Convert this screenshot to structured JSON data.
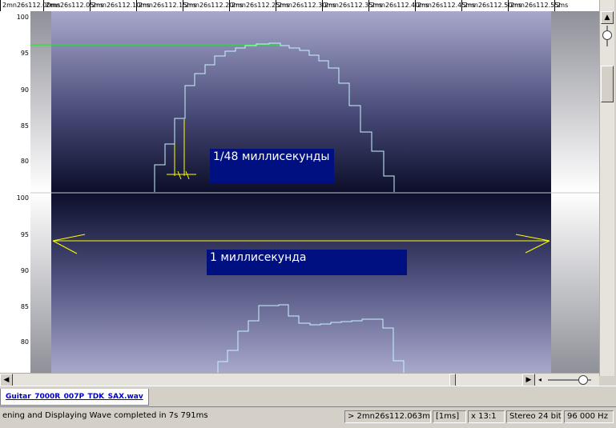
{
  "ruler": {
    "ticks": [
      "2mn26s112.00ms",
      "2mn26s112.05ms",
      "2mn26s112.10ms",
      "2mn26s112.15ms",
      "2mn26s112.20ms",
      "2mn26s112.25ms",
      "2mn26s112.30ms",
      "2mn26s112.35ms",
      "2mn26s112.40ms",
      "2mn26s112.45ms",
      "2mn26s112.50ms",
      "2mn26s112.55ms",
      "2"
    ]
  },
  "axis": {
    "top_labels": [
      "100",
      "95",
      "90",
      "85",
      "80"
    ],
    "bottom_labels": [
      "100",
      "95",
      "90",
      "85",
      "80"
    ]
  },
  "annotations": {
    "sample_label": "1/48 миллисекунды",
    "ms_label": "1 миллисекунда"
  },
  "tab": {
    "filename": "Guitar_7000R_007P_TDK_SAX.wav"
  },
  "status": {
    "message": "ening and Displaying Wave completed in 7s 791ms",
    "position": "> 2mn26s112.063ms",
    "selection": "[1ms]",
    "zoom": "x 13:1",
    "format": "Stereo 24 bit",
    "rate": "96 000 Hz"
  },
  "colors": {
    "wave_line": "#c8f4ff",
    "annotation_line": "#ffff00",
    "cursor_line": "#00ff00",
    "annotation_box": "#001080"
  }
}
